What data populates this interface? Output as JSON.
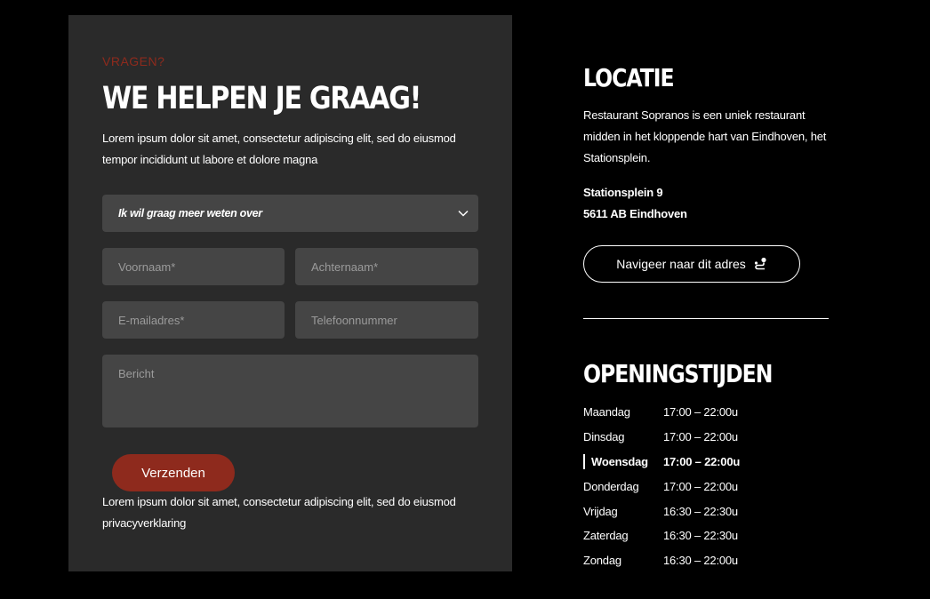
{
  "contact": {
    "eyebrow": "VRAGEN?",
    "heading": "WE HELPEN JE GRAAG!",
    "intro": "Lorem ipsum dolor sit amet, consectetur adipiscing elit, sed do eiusmod tempor incididunt ut labore et dolore magna",
    "select_value": "Ik wil graag meer weten over",
    "placeholders": {
      "first_name": "Voornaam*",
      "last_name": "Achternaam*",
      "email": "E-mailadres*",
      "phone": "Telefoonnummer",
      "message": "Bericht"
    },
    "submit_label": "Verzenden",
    "privacy_text": "Lorem ipsum dolor sit amet, consectetur adipiscing elit, sed do eiusmod privacyverklaring"
  },
  "location": {
    "heading": "LOCATIE",
    "description": "Restaurant Sopranos is een uniek restaurant midden in het kloppende hart van Eindhoven, het Stationsplein.",
    "address_line1": "Stationsplein 9",
    "address_line2": "5611 AB Eindhoven",
    "navigate_label": "Navigeer naar dit adres",
    "navigate_icon": "route-icon"
  },
  "opening_hours": {
    "heading": "OPENINGSTIJDEN",
    "days": [
      {
        "day": "Maandag",
        "hours": "17:00 – 22:00u"
      },
      {
        "day": "Dinsdag",
        "hours": "17:00 – 22:00u"
      },
      {
        "day": "Woensdag",
        "hours": "17:00 – 22:00u",
        "active": true
      },
      {
        "day": "Donderdag",
        "hours": "17:00 – 22:00u"
      },
      {
        "day": "Vrijdag",
        "hours": "16:30 – 22:30u"
      },
      {
        "day": "Zaterdag",
        "hours": "16:30 – 22:30u"
      },
      {
        "day": "Zondag",
        "hours": "16:30 – 22:00u"
      }
    ]
  },
  "colors": {
    "accent": "#8e2a1d",
    "panel": "#2a2a2a",
    "field": "#454545",
    "background": "#000000"
  }
}
